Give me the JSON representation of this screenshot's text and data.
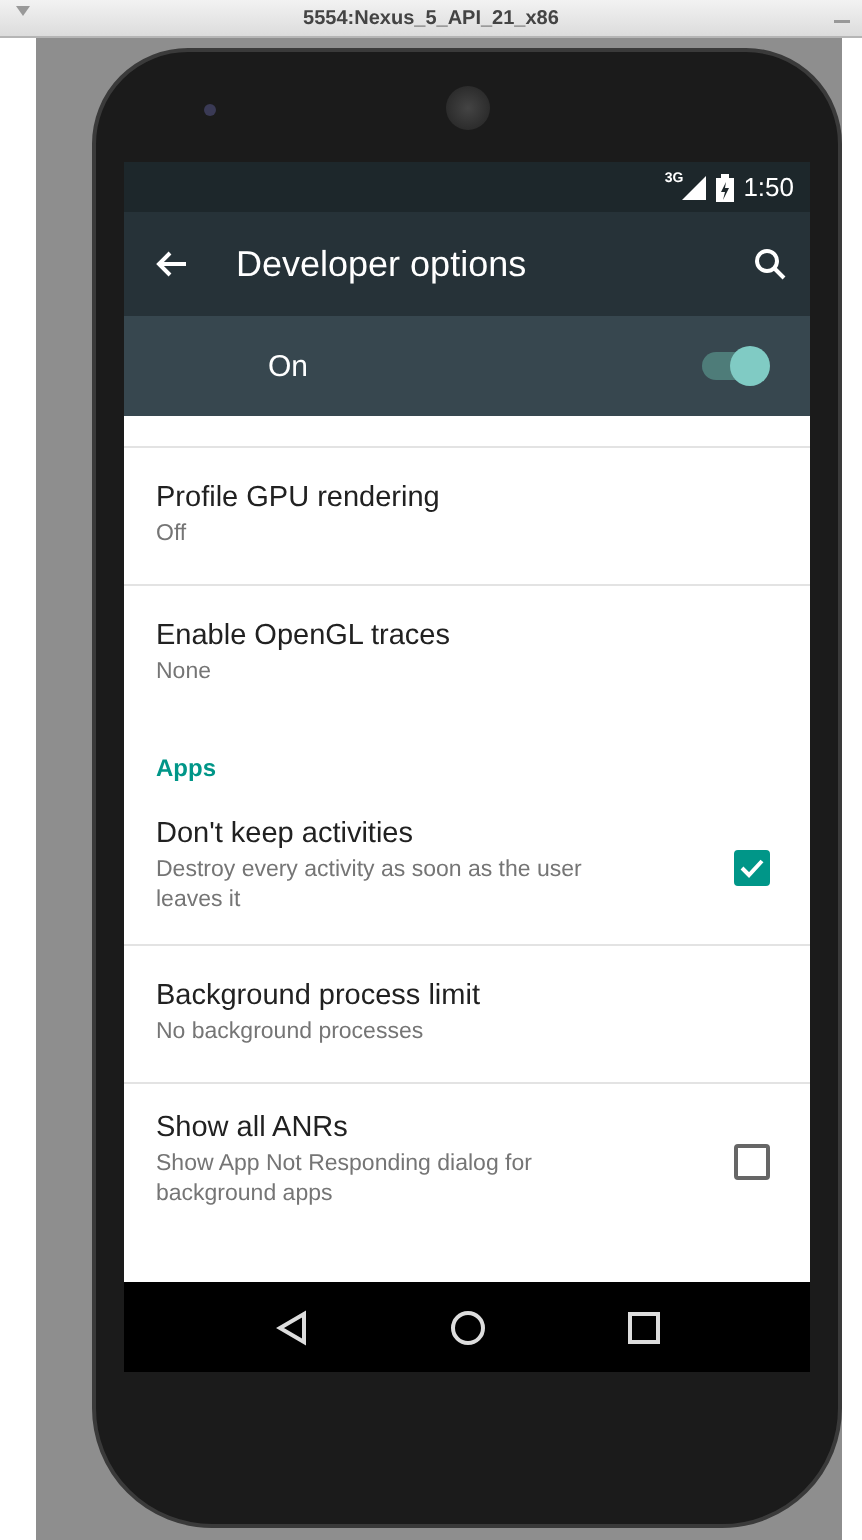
{
  "window": {
    "title": "5554:Nexus_5_API_21_x86"
  },
  "status_bar": {
    "network": "3G",
    "time": "1:50"
  },
  "toolbar": {
    "title": "Developer options"
  },
  "master_switch": {
    "label": "On",
    "on": true
  },
  "settings": [
    {
      "kind": "item",
      "title": "Profile GPU rendering",
      "summary": "Off"
    },
    {
      "kind": "item",
      "title": "Enable OpenGL traces",
      "summary": "None"
    },
    {
      "kind": "header",
      "title": "Apps"
    },
    {
      "kind": "checkbox",
      "title": "Don't keep activities",
      "summary": "Destroy every activity as soon as the user leaves it",
      "checked": true
    },
    {
      "kind": "item",
      "title": "Background process limit",
      "summary": "No background processes"
    },
    {
      "kind": "checkbox",
      "title": "Show all ANRs",
      "summary": "Show App Not Responding dialog for background apps",
      "checked": false
    }
  ]
}
